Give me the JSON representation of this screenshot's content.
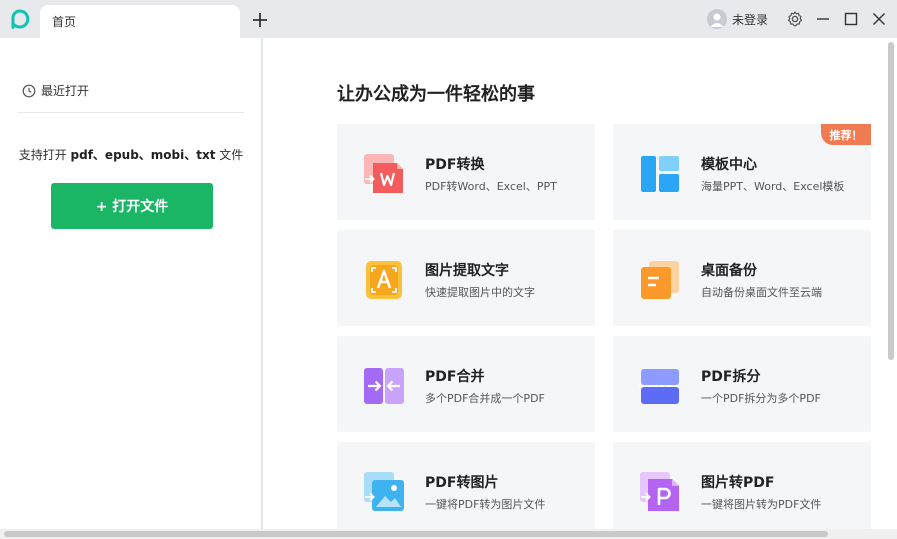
{
  "titlebar": {
    "tab_label": "首页",
    "user_label": "未登录"
  },
  "sidebar": {
    "recent_label": "最近打开",
    "support_prefix": "支持打开 ",
    "support_formats": "pdf、epub、mobi、txt",
    "support_suffix": " 文件",
    "open_button": "+ 打开文件"
  },
  "main": {
    "headline": "让办公成为一件轻松的事",
    "badge": "推荐！",
    "cards": [
      {
        "title": "PDF转换",
        "desc": "PDF转Word、Excel、PPT",
        "icon": "pdf-to-word-icon"
      },
      {
        "title": "模板中心",
        "desc": "海量PPT、Word、Excel模板",
        "icon": "template-icon"
      },
      {
        "title": "图片提取文字",
        "desc": "快速提取图片中的文字",
        "icon": "ocr-icon"
      },
      {
        "title": "桌面备份",
        "desc": "自动备份桌面文件至云端",
        "icon": "desktop-backup-icon"
      },
      {
        "title": "PDF合并",
        "desc": "多个PDF合并成一个PDF",
        "icon": "merge-icon"
      },
      {
        "title": "PDF拆分",
        "desc": "一个PDF拆分为多个PDF",
        "icon": "split-icon"
      },
      {
        "title": "PDF转图片",
        "desc": "一键将PDF转为图片文件",
        "icon": "pdf-to-image-icon"
      },
      {
        "title": "图片转PDF",
        "desc": "一键将图片转为PDF文件",
        "icon": "image-to-pdf-icon"
      }
    ]
  },
  "colors": {
    "accent_green": "#1ab666",
    "badge_orange": "#f07b52",
    "logo_teal": "#11c3b1"
  }
}
